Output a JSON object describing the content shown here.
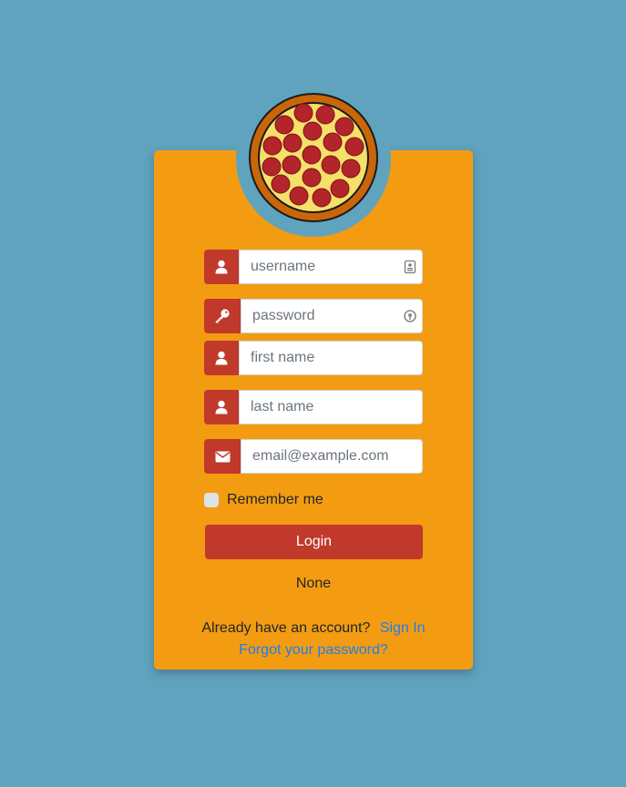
{
  "colors": {
    "background": "#5fa3bf",
    "card": "#f39c12",
    "accent": "#c0392b",
    "link": "#1e7ef0"
  },
  "form": {
    "username": {
      "value": "",
      "placeholder": "username",
      "icon": "user-icon",
      "trailing_icon": "contact-card-icon"
    },
    "password": {
      "value": "",
      "placeholder": "password",
      "icon": "key-icon",
      "trailing_icon": "password-manager-icon"
    },
    "first_name": {
      "value": "",
      "placeholder": "first name",
      "icon": "user-icon"
    },
    "last_name": {
      "value": "",
      "placeholder": "last name",
      "icon": "user-icon"
    },
    "email": {
      "value": "",
      "placeholder": "email@example.com",
      "icon": "envelope-icon"
    },
    "remember_label": "Remember me",
    "remember_checked": false,
    "login_label": "Login",
    "status_text": "None"
  },
  "footer": {
    "account_text": "Already have an account?",
    "sign_in_label": "Sign In",
    "forgot_label": "Forgot your password?"
  }
}
